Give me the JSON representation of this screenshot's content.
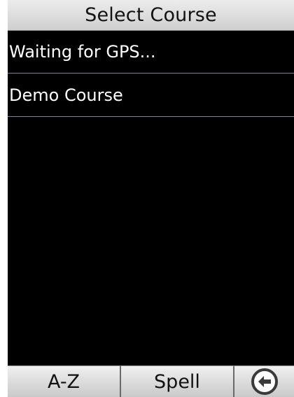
{
  "title": "Select Course",
  "list": {
    "items": [
      {
        "label": "Waiting for GPS..."
      },
      {
        "label": "Demo Course"
      }
    ]
  },
  "bottom_bar": {
    "az_label": "A-Z",
    "spell_label": "Spell",
    "back_icon": "arrow-left-circle-icon"
  },
  "colors": {
    "list_background": "#000000",
    "list_text": "#ffffff",
    "divider": "#6f8aa6",
    "header_background": "#dcdcdc"
  }
}
